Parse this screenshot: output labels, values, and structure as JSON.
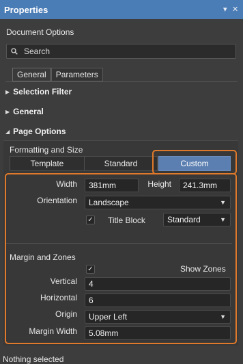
{
  "window": {
    "title": "Properties",
    "pin_icon": "▾",
    "close_icon": "✕"
  },
  "header": {
    "subtitle": "Document Options"
  },
  "search": {
    "placeholder": "Search"
  },
  "tabs": [
    {
      "label": "General",
      "active": true
    },
    {
      "label": "Parameters",
      "active": false
    }
  ],
  "sections": {
    "selection_filter": "Selection Filter",
    "general": "General",
    "page_options": "Page Options"
  },
  "page_options": {
    "formatting_label": "Formatting and Size",
    "modes": [
      "Template",
      "Standard",
      "Custom"
    ],
    "selected_mode": "Custom",
    "width_label": "Width",
    "width_value": "381mm",
    "height_label": "Height",
    "height_value": "241.3mm",
    "orientation_label": "Orientation",
    "orientation_value": "Landscape",
    "title_block_label": "Title Block",
    "title_block_checked": true,
    "title_block_value": "Standard",
    "margin_zones_label": "Margin and Zones",
    "show_zones_label": "Show Zones",
    "show_zones_checked": true,
    "vertical_label": "Vertical",
    "vertical_value": "4",
    "horizontal_label": "Horizontal",
    "horizontal_value": "6",
    "origin_label": "Origin",
    "origin_value": "Upper Left",
    "margin_width_label": "Margin Width",
    "margin_width_value": "5.08mm"
  },
  "status_bar": {
    "text": "Nothing selected"
  },
  "colors": {
    "title_bar": "#4a7cb6",
    "background": "#3d3d3d",
    "selected_segment": "#5b7fb0",
    "highlight": "#e07a2a"
  }
}
